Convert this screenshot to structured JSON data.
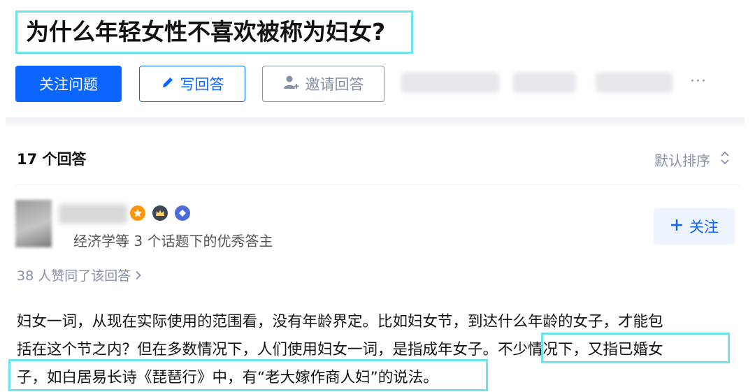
{
  "question": {
    "title": "为什么年轻女性不喜欢被称为妇女?"
  },
  "actions": {
    "follow_label": "关注问题",
    "write_label": "写回答",
    "invite_label": "邀请回答",
    "more_label": "···"
  },
  "answers": {
    "count_label": "17 个回答",
    "sort_label": "默认排序"
  },
  "answer": {
    "author_desc": "经济学等 3 个话题下的优秀答主",
    "follow_label": "关注",
    "likes_label": "38 人赞同了该回答",
    "content_lines": [
      "妇女一词，从现在实际使用的范围看，没有年龄界定。比如妇女节，到达什么年龄的女子，才能包",
      "括在这个节之内？但在多数情况下，人们使用妇女一词，是指成年女子。",
      "不少情况下，又指已婚女",
      "子，如白居易长诗《琵琶行》中，有“老大嫁作商人妇”的说法。"
    ]
  },
  "colors": {
    "accent": "#0a66ff",
    "highlight_border": "#6fe3ea",
    "muted": "#8590a6"
  },
  "icons": {
    "write": "pencil-icon",
    "invite": "person-plus-icon",
    "sort": "sort-updown-icon",
    "plus": "plus-icon"
  }
}
